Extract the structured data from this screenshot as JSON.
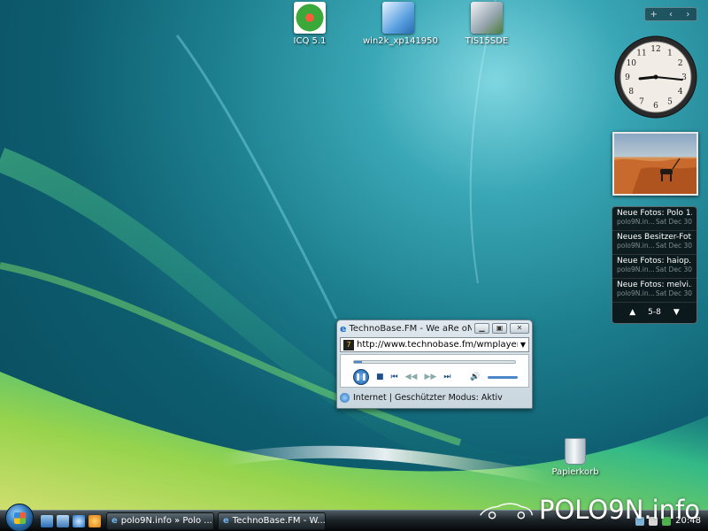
{
  "desktop": {
    "icons": [
      {
        "label": "ICQ 5.1",
        "icon": "icq-flower-icon"
      },
      {
        "label": "win2k_xp141950",
        "icon": "installer-icon"
      },
      {
        "label": "TIS15SDE",
        "icon": "setup-icon"
      }
    ],
    "recycle_bin": "Papierkorb"
  },
  "sidebar": {
    "controls": [
      "+",
      "‹",
      "›"
    ],
    "clock": {
      "numerals": [
        "12",
        "1",
        "2",
        "3",
        "4",
        "5",
        "6",
        "7",
        "8",
        "9",
        "10",
        "11"
      ],
      "time_hour": 8.8,
      "time_minute": 16
    },
    "feeds": {
      "items": [
        {
          "title": "Neue Fotos: Polo 1...",
          "source": "polo9N.in...",
          "date": "Sat Dec 30"
        },
        {
          "title": "Neues Besitzer-Fot...",
          "source": "polo9N.in...",
          "date": "Sat Dec 30"
        },
        {
          "title": "Neue Fotos: haiop...",
          "source": "polo9N.in...",
          "date": "Sat Dec 30"
        },
        {
          "title": "Neue Fotos: melvi...",
          "source": "polo9N.in...",
          "date": "Sat Dec 30"
        }
      ],
      "range": "5-8"
    }
  },
  "browser_window": {
    "title": "TechnoBase.FM - We aRe oN...",
    "url": "http://www.technobase.fm/wmplayer.php?",
    "player": {
      "progress": 0.05
    },
    "status": "Internet | Geschützter Modus: Aktiv"
  },
  "taskbar": {
    "tasks": [
      {
        "label": "polo9N.info » Polo ..."
      },
      {
        "label": "TechnoBase.FM - W..."
      }
    ],
    "clock": "20:48"
  },
  "watermark": "POLO9N.info",
  "colors": {
    "accent": "#2e77b8",
    "feed_bg": "#0a0c0e"
  }
}
